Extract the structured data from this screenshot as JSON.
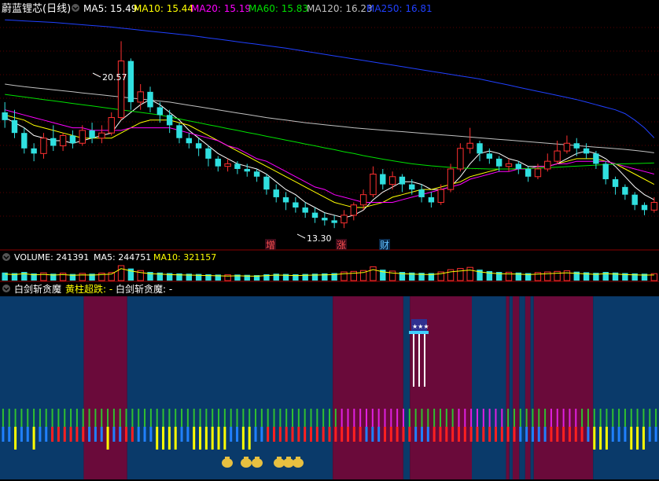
{
  "header": {
    "stock_name": "蔚蓝锂芯",
    "period": "(日线)",
    "ma_labels": [
      {
        "text": "MA5: 15.49",
        "color": "#ffffff"
      },
      {
        "text": "MA10: 15.44",
        "color": "#ffff00"
      },
      {
        "text": "MA20: 15.19",
        "color": "#ff00ff"
      },
      {
        "text": "MA60: 15.83",
        "color": "#00e000"
      },
      {
        "text": "MA120: 16.23",
        "color": "#c0c0c0"
      },
      {
        "text": "MA250: 16.81",
        "color": "#2040ff"
      }
    ]
  },
  "volume_header": {
    "items": [
      {
        "text": "VOLUME: 241391",
        "color": "#ffffff"
      },
      {
        "text": "MA5: 244751",
        "color": "#ffffff"
      },
      {
        "text": "MA10: 321157",
        "color": "#ffff00"
      }
    ]
  },
  "indicator_header": {
    "name": "白剑斩贪魔",
    "signal_label": "黄柱超跌: -",
    "signal_value": "白剑斩贪魔: -"
  },
  "annotations": {
    "high": "20.57",
    "low": "13.30",
    "markers": [
      "增",
      "涨",
      "财"
    ]
  },
  "colors": {
    "up": "#ff3030",
    "down": "#30e0e0",
    "ma5": "#ffffff",
    "ma10": "#ffff00",
    "ma20": "#ff00ff",
    "ma60": "#00e000",
    "ma120": "#c0c0c0",
    "ma250": "#2040ff",
    "bg_blue": "#0a3a6a",
    "bg_maroon": "#6a0a3a"
  },
  "chart_data": {
    "type": "candlestick",
    "ylim": [
      13.0,
      21.5
    ],
    "candles": [
      [
        17.8,
        17.5,
        18.2,
        17.2
      ],
      [
        17.5,
        17.0,
        17.9,
        16.8
      ],
      [
        17.0,
        16.4,
        17.2,
        16.2
      ],
      [
        16.4,
        16.2,
        16.6,
        15.9
      ],
      [
        16.2,
        16.8,
        17.0,
        16.0
      ],
      [
        16.8,
        16.5,
        17.3,
        16.3
      ],
      [
        16.5,
        16.9,
        17.0,
        16.3
      ],
      [
        16.9,
        16.6,
        17.1,
        16.4
      ],
      [
        16.6,
        17.1,
        17.3,
        16.5
      ],
      [
        17.1,
        16.8,
        17.4,
        16.6
      ],
      [
        16.8,
        17.0,
        17.3,
        16.6
      ],
      [
        17.0,
        17.6,
        17.8,
        16.9
      ],
      [
        17.6,
        19.8,
        20.57,
        17.5
      ],
      [
        19.8,
        18.2,
        19.9,
        17.9
      ],
      [
        18.2,
        18.6,
        18.9,
        17.9
      ],
      [
        18.6,
        18.0,
        18.8,
        17.8
      ],
      [
        18.0,
        17.7,
        18.2,
        17.4
      ],
      [
        17.7,
        17.3,
        17.9,
        17.0
      ],
      [
        17.3,
        16.8,
        17.4,
        16.6
      ],
      [
        16.8,
        16.6,
        17.0,
        16.4
      ],
      [
        16.6,
        16.4,
        16.8,
        16.1
      ],
      [
        16.4,
        16.0,
        16.5,
        15.7
      ],
      [
        16.0,
        15.7,
        16.1,
        15.5
      ],
      [
        15.7,
        15.8,
        16.0,
        15.5
      ],
      [
        15.8,
        15.6,
        15.9,
        15.4
      ],
      [
        15.6,
        15.5,
        15.8,
        15.3
      ],
      [
        15.5,
        15.3,
        15.6,
        15.1
      ],
      [
        15.3,
        14.8,
        15.4,
        14.6
      ],
      [
        14.8,
        14.5,
        15.0,
        14.3
      ],
      [
        14.5,
        14.3,
        14.7,
        14.0
      ],
      [
        14.3,
        14.1,
        14.5,
        13.9
      ],
      [
        14.1,
        13.9,
        14.3,
        13.7
      ],
      [
        13.9,
        13.7,
        14.1,
        13.5
      ],
      [
        13.7,
        13.6,
        13.9,
        13.4
      ],
      [
        13.6,
        13.5,
        13.8,
        13.3
      ],
      [
        13.5,
        13.8,
        14.0,
        13.3
      ],
      [
        13.8,
        14.2,
        14.3,
        13.6
      ],
      [
        14.2,
        14.6,
        14.8,
        14.0
      ],
      [
        14.6,
        15.4,
        15.7,
        14.5
      ],
      [
        15.4,
        15.0,
        15.6,
        14.8
      ],
      [
        15.0,
        15.3,
        15.5,
        14.8
      ],
      [
        15.3,
        15.0,
        15.4,
        14.7
      ],
      [
        15.0,
        14.8,
        15.2,
        14.6
      ],
      [
        14.8,
        14.5,
        15.0,
        14.3
      ],
      [
        14.5,
        14.3,
        14.7,
        14.1
      ],
      [
        14.3,
        14.8,
        15.0,
        14.2
      ],
      [
        14.8,
        15.6,
        15.8,
        14.7
      ],
      [
        15.6,
        16.4,
        16.6,
        15.5
      ],
      [
        16.4,
        16.6,
        17.2,
        16.2
      ],
      [
        16.6,
        16.2,
        16.7,
        15.9
      ],
      [
        16.2,
        16.0,
        16.4,
        15.8
      ],
      [
        16.0,
        15.7,
        16.1,
        15.5
      ],
      [
        15.7,
        15.8,
        16.0,
        15.5
      ],
      [
        15.8,
        15.6,
        15.9,
        15.4
      ],
      [
        15.6,
        15.3,
        15.7,
        15.1
      ],
      [
        15.3,
        15.6,
        15.8,
        15.2
      ],
      [
        15.6,
        15.9,
        16.2,
        15.5
      ],
      [
        15.9,
        16.3,
        16.7,
        15.8
      ],
      [
        16.3,
        16.6,
        16.9,
        16.2
      ],
      [
        16.6,
        16.4,
        16.8,
        16.1
      ],
      [
        16.4,
        16.2,
        16.6,
        16.0
      ],
      [
        16.2,
        15.8,
        16.3,
        15.6
      ],
      [
        15.8,
        15.2,
        15.9,
        15.0
      ],
      [
        15.2,
        14.9,
        15.3,
        14.6
      ],
      [
        14.9,
        14.6,
        15.0,
        14.4
      ],
      [
        14.6,
        14.2,
        14.7,
        14.0
      ],
      [
        14.2,
        14.0,
        14.3,
        13.8
      ],
      [
        14.0,
        14.3,
        14.5,
        13.9
      ]
    ],
    "ma_lines": [
      {
        "name": "MA5",
        "values": [
          17.6,
          17.4,
          17.2,
          16.9,
          16.8,
          16.7,
          16.7,
          16.6,
          16.7,
          16.8,
          16.9,
          17.0,
          17.5,
          17.8,
          18.1,
          18.3,
          18.1,
          17.8,
          17.5,
          17.1,
          16.8,
          16.5,
          16.2,
          16.0,
          15.8,
          15.7,
          15.6,
          15.4,
          15.1,
          14.8,
          14.6,
          14.3,
          14.1,
          13.9,
          13.8,
          13.7,
          13.8,
          14.0,
          14.4,
          14.7,
          14.9,
          15.1,
          15.1,
          15.0,
          14.8,
          14.8,
          14.9,
          15.3,
          15.8,
          16.2,
          16.3,
          16.2,
          16.0,
          15.9,
          15.7,
          15.7,
          15.7,
          15.8,
          16.0,
          16.2,
          16.3,
          16.2,
          16.0,
          15.7,
          15.3,
          14.9,
          14.6,
          14.4
        ]
      },
      {
        "name": "MA10",
        "values": [
          17.7,
          17.6,
          17.5,
          17.3,
          17.2,
          17.1,
          17.0,
          16.9,
          16.8,
          16.8,
          16.8,
          16.8,
          17.0,
          17.2,
          17.4,
          17.5,
          17.5,
          17.5,
          17.4,
          17.3,
          17.1,
          16.9,
          16.7,
          16.5,
          16.3,
          16.1,
          15.9,
          15.7,
          15.5,
          15.3,
          15.1,
          14.9,
          14.7,
          14.5,
          14.3,
          14.2,
          14.1,
          14.1,
          14.2,
          14.3,
          14.5,
          14.6,
          14.7,
          14.8,
          14.8,
          14.9,
          15.0,
          15.1,
          15.3,
          15.4,
          15.5,
          15.6,
          15.6,
          15.6,
          15.6,
          15.7,
          15.7,
          15.8,
          15.9,
          16.0,
          16.0,
          16.0,
          15.9,
          15.8,
          15.6,
          15.4,
          15.2,
          15.0
        ]
      },
      {
        "name": "MA20",
        "values": [
          17.9,
          17.8,
          17.7,
          17.6,
          17.5,
          17.4,
          17.3,
          17.2,
          17.2,
          17.1,
          17.1,
          17.1,
          17.1,
          17.2,
          17.2,
          17.2,
          17.2,
          17.2,
          17.1,
          17.0,
          16.9,
          16.8,
          16.7,
          16.5,
          16.4,
          16.2,
          16.0,
          15.9,
          15.7,
          15.5,
          15.3,
          15.1,
          14.9,
          14.8,
          14.6,
          14.5,
          14.4,
          14.3,
          14.3,
          14.3,
          14.3,
          14.4,
          14.5,
          14.6,
          14.7,
          14.8,
          14.9,
          15.0,
          15.2,
          15.3,
          15.4,
          15.5,
          15.5,
          15.6,
          15.6,
          15.7,
          15.7,
          15.8,
          15.8,
          15.9,
          15.9,
          15.9,
          15.9,
          15.8,
          15.7,
          15.6,
          15.5,
          15.4
        ]
      },
      {
        "name": "MA60",
        "values": [
          18.5,
          18.45,
          18.4,
          18.35,
          18.3,
          18.25,
          18.2,
          18.15,
          18.1,
          18.05,
          18.0,
          17.95,
          17.9,
          17.85,
          17.8,
          17.75,
          17.7,
          17.62,
          17.55,
          17.47,
          17.4,
          17.32,
          17.25,
          17.17,
          17.1,
          17.02,
          16.95,
          16.87,
          16.8,
          16.72,
          16.65,
          16.57,
          16.5,
          16.42,
          16.35,
          16.27,
          16.2,
          16.12,
          16.05,
          15.98,
          15.92,
          15.86,
          15.8,
          15.76,
          15.72,
          15.69,
          15.66,
          15.64,
          15.62,
          15.61,
          15.6,
          15.6,
          15.6,
          15.61,
          15.62,
          15.63,
          15.65,
          15.67,
          15.69,
          15.71,
          15.73,
          15.75,
          15.77,
          15.79,
          15.8,
          15.81,
          15.82,
          15.83
        ]
      },
      {
        "name": "MA120",
        "values": [
          18.9,
          18.85,
          18.8,
          18.76,
          18.72,
          18.68,
          18.64,
          18.6,
          18.56,
          18.52,
          18.48,
          18.44,
          18.4,
          18.36,
          18.32,
          18.28,
          18.24,
          18.2,
          18.14,
          18.08,
          18.02,
          17.96,
          17.9,
          17.84,
          17.78,
          17.72,
          17.66,
          17.6,
          17.55,
          17.5,
          17.45,
          17.4,
          17.36,
          17.32,
          17.28,
          17.24,
          17.2,
          17.17,
          17.14,
          17.11,
          17.08,
          17.05,
          17.02,
          16.99,
          16.96,
          16.93,
          16.9,
          16.87,
          16.84,
          16.81,
          16.78,
          16.75,
          16.72,
          16.69,
          16.66,
          16.63,
          16.6,
          16.57,
          16.54,
          16.51,
          16.48,
          16.45,
          16.42,
          16.39,
          16.36,
          16.32,
          16.28,
          16.23
        ]
      },
      {
        "name": "MA250",
        "values": [
          21.4,
          21.38,
          21.36,
          21.34,
          21.32,
          21.3,
          21.27,
          21.24,
          21.21,
          21.18,
          21.15,
          21.12,
          21.08,
          21.04,
          21.0,
          20.96,
          20.92,
          20.88,
          20.84,
          20.8,
          20.75,
          20.7,
          20.65,
          20.6,
          20.55,
          20.5,
          20.45,
          20.4,
          20.35,
          20.3,
          20.24,
          20.18,
          20.12,
          20.06,
          20.0,
          19.94,
          19.88,
          19.82,
          19.76,
          19.7,
          19.64,
          19.58,
          19.52,
          19.46,
          19.4,
          19.34,
          19.28,
          19.22,
          19.16,
          19.1,
          19.02,
          18.94,
          18.86,
          18.78,
          18.7,
          18.62,
          18.54,
          18.46,
          18.38,
          18.3,
          18.2,
          18.1,
          18.0,
          17.9,
          17.75,
          17.5,
          17.2,
          16.81
        ]
      }
    ],
    "volume": [
      280000,
      260000,
      300000,
      250000,
      270000,
      240000,
      260000,
      230000,
      250000,
      240000,
      260000,
      280000,
      520000,
      420000,
      350000,
      300000,
      280000,
      260000,
      250000,
      240000,
      230000,
      220000,
      210000,
      200000,
      210000,
      200000,
      190000,
      220000,
      240000,
      230000,
      220000,
      230000,
      240000,
      250000,
      260000,
      300000,
      320000,
      350000,
      480000,
      380000,
      330000,
      300000,
      280000,
      270000,
      260000,
      300000,
      380000,
      420000,
      460000,
      380000,
      330000,
      300000,
      290000,
      280000,
      260000,
      280000,
      300000,
      320000,
      340000,
      310000,
      290000,
      270000,
      300000,
      280000,
      260000,
      250000,
      240000,
      241391
    ],
    "indicator_regions": [
      {
        "from": 0.0,
        "to": 0.127,
        "color": "blue"
      },
      {
        "from": 0.127,
        "to": 0.193,
        "color": "maroon"
      },
      {
        "from": 0.193,
        "to": 0.505,
        "color": "blue"
      },
      {
        "from": 0.505,
        "to": 0.612,
        "color": "maroon"
      },
      {
        "from": 0.612,
        "to": 0.622,
        "color": "blue"
      },
      {
        "from": 0.622,
        "to": 0.716,
        "color": "maroon"
      },
      {
        "from": 0.716,
        "to": 0.768,
        "color": "blue"
      },
      {
        "from": 0.768,
        "to": 0.773,
        "color": "maroon"
      },
      {
        "from": 0.773,
        "to": 0.778,
        "color": "blue"
      },
      {
        "from": 0.778,
        "to": 0.788,
        "color": "maroon"
      },
      {
        "from": 0.788,
        "to": 0.797,
        "color": "blue"
      },
      {
        "from": 0.797,
        "to": 0.805,
        "color": "maroon"
      },
      {
        "from": 0.805,
        "to": 0.81,
        "color": "blue"
      },
      {
        "from": 0.81,
        "to": 0.9,
        "color": "maroon"
      },
      {
        "from": 0.9,
        "to": 1.0,
        "color": "blue"
      }
    ],
    "indicator_bar_colors": [
      "blue",
      "blue",
      "yellow",
      "blue",
      "blue",
      "yellow",
      "blue",
      "blue",
      "red",
      "red",
      "red",
      "red",
      "red",
      "red",
      "blue",
      "blue",
      "blue",
      "yellow",
      "blue",
      "blue",
      "red",
      "red",
      "blue",
      "blue",
      "blue",
      "yellow",
      "yellow",
      "yellow",
      "yellow",
      "blue",
      "blue",
      "yellow",
      "yellow",
      "yellow",
      "yellow",
      "yellow",
      "yellow",
      "blue",
      "blue",
      "yellow",
      "yellow",
      "blue",
      "blue",
      "red",
      "red",
      "red",
      "red",
      "red",
      "red",
      "red",
      "red",
      "red",
      "red",
      "red",
      "red",
      "red",
      "red",
      "red",
      "red",
      "blue",
      "blue",
      "blue",
      "red",
      "red",
      "red",
      "red",
      "red",
      "blue",
      "blue",
      "blue",
      "red",
      "red",
      "red",
      "red",
      "red",
      "red",
      "red",
      "red",
      "red",
      "red",
      "red",
      "red",
      "red",
      "red",
      "blue",
      "blue",
      "blue",
      "blue",
      "blue",
      "red",
      "red",
      "red",
      "red",
      "red",
      "red",
      "blue",
      "yellow",
      "yellow",
      "yellow",
      "blue",
      "blue",
      "blue",
      "yellow",
      "yellow",
      "yellow",
      "blue",
      "blue"
    ],
    "indicator_top_colors": [
      "green",
      "green",
      "green",
      "green",
      "green",
      "green",
      "green",
      "green",
      "green",
      "green",
      "green",
      "green",
      "green",
      "green",
      "green",
      "green",
      "green",
      "green",
      "green",
      "green",
      "green",
      "green",
      "green",
      "green",
      "green",
      "green",
      "green",
      "green",
      "green",
      "green",
      "green",
      "green",
      "green",
      "green",
      "green",
      "green",
      "green",
      "green",
      "green",
      "green",
      "green",
      "green",
      "green",
      "green",
      "green",
      "green",
      "green",
      "green",
      "green",
      "green",
      "green",
      "green",
      "green",
      "green",
      "green",
      "magenta",
      "magenta",
      "magenta",
      "magenta",
      "magenta",
      "magenta",
      "magenta",
      "magenta",
      "magenta",
      "magenta",
      "magenta",
      "green",
      "green",
      "green",
      "green",
      "green",
      "green",
      "green",
      "green",
      "magenta",
      "magenta",
      "magenta",
      "magenta",
      "magenta",
      "magenta",
      "magenta",
      "magenta",
      "green",
      "green",
      "green",
      "green",
      "green",
      "green",
      "green",
      "magenta",
      "magenta",
      "magenta",
      "magenta",
      "magenta",
      "green",
      "green",
      "green",
      "green",
      "green",
      "green",
      "green",
      "green",
      "green",
      "green",
      "green",
      "green"
    ]
  }
}
